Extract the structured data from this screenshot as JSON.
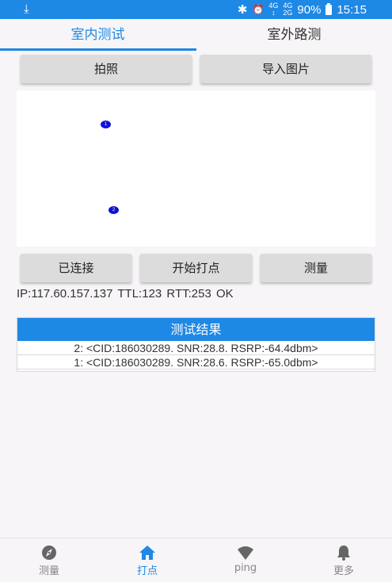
{
  "status_bar": {
    "download_glyph": "⤓",
    "bluetooth_glyph": "✱",
    "alarm_glyph": "⏰",
    "network_4g_top": "4G",
    "network_4g_bottom": "↕",
    "network_signal_top": "4G",
    "network_signal_bottom": "2G",
    "battery": "90%",
    "time": "15:15"
  },
  "tabs": [
    {
      "label": "室内测试",
      "active": true
    },
    {
      "label": "室外路测",
      "active": false
    }
  ],
  "top_buttons": {
    "photo": "拍照",
    "import_image": "导入图片"
  },
  "canvas": {
    "markers": [
      {
        "label": "1"
      },
      {
        "label": "2"
      }
    ],
    "marker_color": "#1010d8"
  },
  "action_buttons": {
    "connected": "已连接",
    "start_marking": "开始打点",
    "measure": "测量"
  },
  "info_line": "IP:117.60.157.137  TTL:123  RTT:253  OK",
  "results": {
    "title": "测试结果",
    "rows": [
      "2: <CID:186030289. SNR:28.8. RSRP:-64.4dbm>",
      "1: <CID:186030289. SNR:28.6. RSRP:-65.0dbm>"
    ]
  },
  "bottom_nav": [
    {
      "label": "测量",
      "icon": "compass-icon",
      "active": false
    },
    {
      "label": "打点",
      "icon": "home-icon",
      "active": true
    },
    {
      "label": "ping",
      "icon": "wifi-icon",
      "active": false
    },
    {
      "label": "更多",
      "icon": "bell-icon",
      "active": false
    }
  ],
  "colors": {
    "accent": "#1e88e5",
    "inactive": "#888888"
  }
}
